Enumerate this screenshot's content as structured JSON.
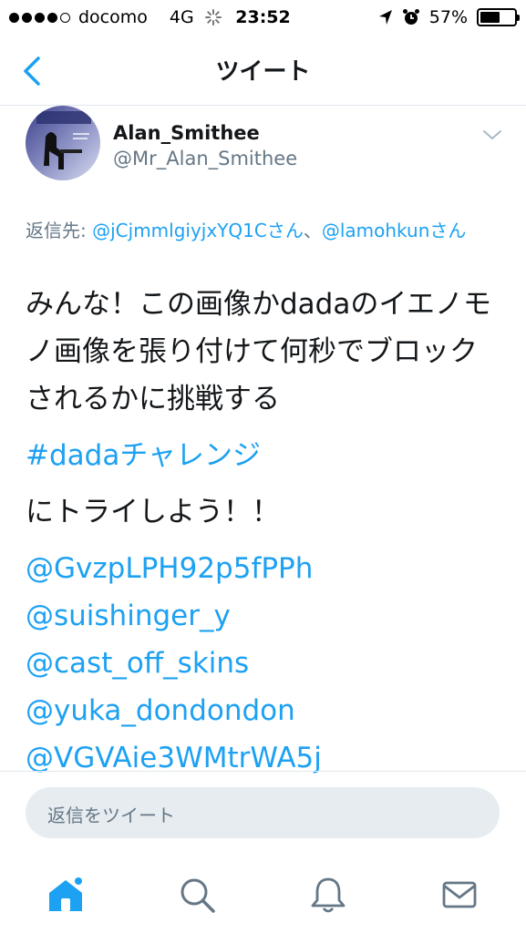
{
  "status_bar": {
    "carrier": "docomo",
    "network": "4G",
    "time": "23:52",
    "battery_percent": "57%",
    "battery_level": 0.57,
    "signal_bars_filled": 4
  },
  "nav": {
    "title": "ツイート",
    "back_icon": "chevron-left-icon"
  },
  "tweet": {
    "author_name": "Alan_Smithee",
    "author_handle": "@Mr_Alan_Smithee",
    "reply_prefix": "返信先: ",
    "reply_user_1": "@jCjmmlgiyjxYQ1Cさん",
    "reply_sep": "、",
    "reply_user_2": "@lamohkunさん",
    "text_line_1": "みんな！この画像かdadaのイエノモノ画像を張り付けて何秒でブロックされるかに挑戦する",
    "hashtag": "#dadaチャレンジ",
    "text_line_2": "にトライしよう！！",
    "mentions": [
      "@GvzpLPH92p5fPPh",
      "@suishinger_y",
      "@cast_off_skins",
      "@yuka_dondondon",
      "@VGVAie3WMtrWA5j"
    ]
  },
  "reply_box": {
    "placeholder": "返信をツイート"
  },
  "tab_bar": {
    "tabs": [
      "home-icon",
      "search-icon",
      "notifications-icon",
      "messages-icon"
    ],
    "accent_color": "#1da1f2",
    "inactive_color": "#657786"
  }
}
